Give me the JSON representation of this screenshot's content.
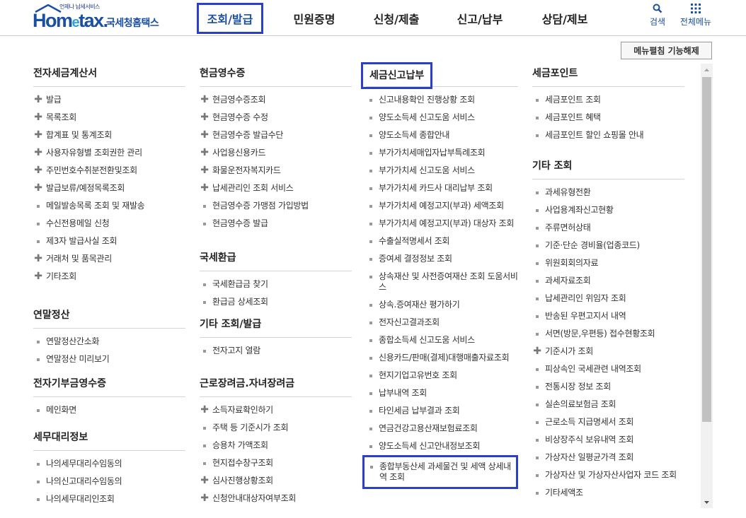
{
  "logo": {
    "tagline": "언제나 납세서비스",
    "brand_a": "Hom",
    "brand_e": "e",
    "brand_b": "tax.",
    "kname": "국세청홈택스"
  },
  "gnb": [
    {
      "label": "조회/발급",
      "active": true
    },
    {
      "label": "민원증명",
      "active": false
    },
    {
      "label": "신청/제출",
      "active": false
    },
    {
      "label": "신고/납부",
      "active": false
    },
    {
      "label": "상담/제보",
      "active": false
    }
  ],
  "util": {
    "search_label": "검색",
    "all_menu_label": "전체메뉴"
  },
  "toggle_button": "메뉴펼침 기능해제",
  "columns": [
    {
      "sections": [
        {
          "title": "전자세금계산서",
          "items": [
            {
              "label": "발급",
              "marker": "plus"
            },
            {
              "label": "목록조회",
              "marker": "plus"
            },
            {
              "label": "합계표 및 통계조회",
              "marker": "plus"
            },
            {
              "label": "사용자유형별 조회권한 관리",
              "marker": "plus"
            },
            {
              "label": "주민번호수취분전환및조회",
              "marker": "plus"
            },
            {
              "label": "발급보류/예정목록조회",
              "marker": "plus"
            },
            {
              "label": "메일발송목록 조회 및 재발송",
              "marker": "dot"
            },
            {
              "label": "수신전용메일 신청",
              "marker": "dot"
            },
            {
              "label": "제3자 발급사실 조회",
              "marker": "dot"
            },
            {
              "label": "거래처 및 품목관리",
              "marker": "plus"
            },
            {
              "label": "기타조회",
              "marker": "plus"
            }
          ]
        },
        {
          "title": "연말정산",
          "items": [
            {
              "label": "연말정산간소화",
              "marker": "dot"
            },
            {
              "label": "연말정산 미리보기",
              "marker": "dot"
            }
          ]
        },
        {
          "title": "전자기부금영수증",
          "items": [
            {
              "label": "메인화면",
              "marker": "dot"
            }
          ]
        },
        {
          "title": "세무대리정보",
          "items": [
            {
              "label": "나의세무대리수임동의",
              "marker": "dot"
            },
            {
              "label": "나의신고대리수임동의",
              "marker": "dot"
            },
            {
              "label": "나의세무대리인조회",
              "marker": "dot"
            }
          ]
        }
      ]
    },
    {
      "sections": [
        {
          "title": "현금영수증",
          "items": [
            {
              "label": "현금영수증조회",
              "marker": "plus"
            },
            {
              "label": "현금영수증 수정",
              "marker": "plus"
            },
            {
              "label": "현금영수증 발급수단",
              "marker": "plus"
            },
            {
              "label": "사업용신용카드",
              "marker": "plus"
            },
            {
              "label": "화물운전자복지카드",
              "marker": "plus"
            },
            {
              "label": "납세관리인 조회 서비스",
              "marker": "plus"
            },
            {
              "label": "현금영수증 가맹점 가입방법",
              "marker": "dot"
            },
            {
              "label": "현금영수증 발급",
              "marker": "dot"
            }
          ]
        },
        {
          "title": "국세환급",
          "items": [
            {
              "label": "국세환급금 찾기",
              "marker": "dot"
            },
            {
              "label": "환급금 상세조회",
              "marker": "dot"
            }
          ]
        },
        {
          "title": "기타 조회/발급",
          "items": [
            {
              "label": "전자고지 열람",
              "marker": "dot"
            }
          ]
        },
        {
          "title": "근로장려금.자녀장려금",
          "items": [
            {
              "label": "소득자료확인하기",
              "marker": "plus"
            },
            {
              "label": "주택 등 기준시가 조회",
              "marker": "dot"
            },
            {
              "label": "승용차 가액조회",
              "marker": "dot"
            },
            {
              "label": "현지접수창구조회",
              "marker": "dot"
            },
            {
              "label": "심사진행상황조회",
              "marker": "plus"
            },
            {
              "label": "신청안내대상자여부조회",
              "marker": "plus"
            }
          ]
        }
      ]
    },
    {
      "sections": [
        {
          "title": "세금신고납부",
          "boxed": true,
          "items": [
            {
              "label": "신고내용확인 진행상황 조회",
              "marker": "dot"
            },
            {
              "label": "양도소득세 신고도움 서비스",
              "marker": "dot"
            },
            {
              "label": "양도소득세 종합안내",
              "marker": "dot"
            },
            {
              "label": "부가가치세매입자납부특례조회",
              "marker": "dot"
            },
            {
              "label": "부가가치세 신고도움 서비스",
              "marker": "dot"
            },
            {
              "label": "부가가치세 카드사 대리납부 조회",
              "marker": "dot"
            },
            {
              "label": "부가가치세 예정고지(부과) 세액조회",
              "marker": "dot"
            },
            {
              "label": "부가가치세 예정고지(부과) 대상자 조회",
              "marker": "dot"
            },
            {
              "label": "수출실적명세서 조회",
              "marker": "dot"
            },
            {
              "label": "증여세 결정정보 조회",
              "marker": "dot"
            },
            {
              "label": "상속재산 및 사전증여재산 조회 도움서비스",
              "marker": "dot"
            },
            {
              "label": "상속.증여재산 평가하기",
              "marker": "dot"
            },
            {
              "label": "전자신고결과조회",
              "marker": "dot"
            },
            {
              "label": "종합소득세 신고도움 서비스",
              "marker": "dot"
            },
            {
              "label": "신용카드/판매(결제)대행매출자료조회",
              "marker": "dot"
            },
            {
              "label": "현지기업고유번호 조회",
              "marker": "dot"
            },
            {
              "label": "납부내역 조회",
              "marker": "dot"
            },
            {
              "label": "타인세금 납부결과 조회",
              "marker": "dot"
            },
            {
              "label": "연금건강고용산재보험료조회",
              "marker": "dot"
            },
            {
              "label": "양도소득세 신고안내정보조회",
              "marker": "dot"
            },
            {
              "label": "종합부동산세 과세물건 및 세액 상세내역 조회",
              "marker": "dot",
              "boxed": true
            }
          ]
        }
      ]
    },
    {
      "sections": [
        {
          "title": "세금포인트",
          "items": [
            {
              "label": "세금포인트 조회",
              "marker": "dot"
            },
            {
              "label": "세금포인트 혜택",
              "marker": "dot"
            },
            {
              "label": "세금포인트 할인 쇼핑몰 안내",
              "marker": "dot"
            }
          ]
        },
        {
          "title": "기타 조회",
          "items": [
            {
              "label": "과세유형전환",
              "marker": "dot"
            },
            {
              "label": "사업용계좌신고현황",
              "marker": "dot"
            },
            {
              "label": "주류면허상태",
              "marker": "dot"
            },
            {
              "label": "기준·단순 경비율(업종코드)",
              "marker": "dot"
            },
            {
              "label": "위원회회의자료",
              "marker": "dot"
            },
            {
              "label": "과세자료조회",
              "marker": "dot"
            },
            {
              "label": "납세관리인 위임자 조회",
              "marker": "dot"
            },
            {
              "label": "반송된 우편고지서 내역",
              "marker": "dot"
            },
            {
              "label": "서면(방문,우편등) 접수현황조회",
              "marker": "dot"
            },
            {
              "label": "기준시가 조회",
              "marker": "plus"
            },
            {
              "label": "피상속인 국세관련 내역조회",
              "marker": "dot"
            },
            {
              "label": "전통시장 정보 조회",
              "marker": "dot"
            },
            {
              "label": "실손의료보험금 조회",
              "marker": "dot"
            },
            {
              "label": "근로소득 지급명세서 조회",
              "marker": "dot"
            },
            {
              "label": "비상장주식 보유내역 조회",
              "marker": "dot"
            },
            {
              "label": "가상자산 일평균가격 조회",
              "marker": "dot"
            },
            {
              "label": "가상자산 및 가상자산사업자 코드 조회",
              "marker": "dot"
            },
            {
              "label": "기타세액조",
              "marker": "dot"
            }
          ]
        }
      ]
    }
  ]
}
